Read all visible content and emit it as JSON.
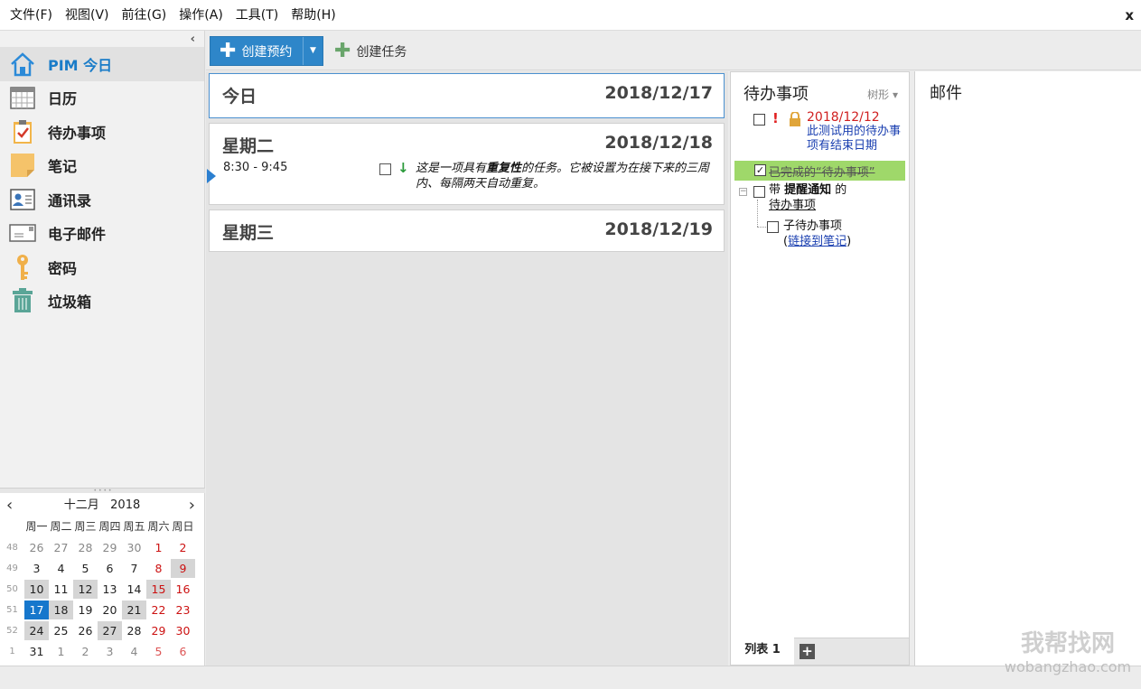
{
  "menu": [
    "文件(F)",
    "视图(V)",
    "前往(G)",
    "操作(A)",
    "工具(T)",
    "帮助(H)"
  ],
  "window_close": "x",
  "sidebar": {
    "collapse": "‹",
    "items": [
      {
        "label": "PIM 今日",
        "icon": "home-icon",
        "active": true
      },
      {
        "label": "日历",
        "icon": "calendar-icon"
      },
      {
        "label": "待办事项",
        "icon": "todo-clipboard-icon"
      },
      {
        "label": "笔记",
        "icon": "note-icon"
      },
      {
        "label": "通讯录",
        "icon": "contacts-icon"
      },
      {
        "label": "电子邮件",
        "icon": "email-icon"
      },
      {
        "label": "密码",
        "icon": "key-icon"
      },
      {
        "label": "垃圾箱",
        "icon": "trash-icon"
      }
    ]
  },
  "minical": {
    "month": "十二月",
    "year": "2018",
    "prev": "‹",
    "next": "›",
    "weekdays": [
      "周一",
      "周二",
      "周三",
      "周四",
      "周五",
      "周六",
      "周日"
    ],
    "weeks": [
      {
        "wk": "48",
        "days": [
          "26",
          "27",
          "28",
          "29",
          "30",
          "1",
          "2"
        ]
      },
      {
        "wk": "49",
        "days": [
          "3",
          "4",
          "5",
          "6",
          "7",
          "8",
          "9"
        ]
      },
      {
        "wk": "50",
        "days": [
          "10",
          "11",
          "12",
          "13",
          "14",
          "15",
          "16"
        ]
      },
      {
        "wk": "51",
        "days": [
          "17",
          "18",
          "19",
          "20",
          "21",
          "22",
          "23"
        ]
      },
      {
        "wk": "52",
        "days": [
          "24",
          "25",
          "26",
          "27",
          "28",
          "29",
          "30"
        ]
      },
      {
        "wk": "1",
        "days": [
          "31",
          "1",
          "2",
          "3",
          "4",
          "5",
          "6"
        ]
      }
    ]
  },
  "toolbar": {
    "new_appointment": "创建预约",
    "new_task": "创建任务"
  },
  "days": [
    {
      "name": "今日",
      "date": "2018/12/17"
    },
    {
      "name": "星期二",
      "date": "2018/12/18",
      "appt_time": "8:30 - 9:45",
      "appt_pre": "这是一项具有",
      "appt_bold": "重复性",
      "appt_post": "的任务。它被设置为在接下来的三周内、每隔两天自动重复。"
    },
    {
      "name": "星期三",
      "date": "2018/12/19"
    }
  ],
  "todo": {
    "title": "待办事项",
    "view_mode": "树形",
    "item1_date": "2018/12/12",
    "item1_desc": "此测试用的待办事项有结束日期",
    "item2": "已完成的“待办事项”",
    "item3_pre": "带 ",
    "item3_bold": "提醒通知",
    "item3_mid": " 的",
    "item3_link": "待办事项",
    "item4": "子待办事项",
    "item4_open": "(",
    "item4_link": "链接到笔记",
    "item4_close": ")",
    "list_tab": "列表 1",
    "add_tab": "+"
  },
  "mail": {
    "title": "邮件"
  },
  "watermark": {
    "line1": "我帮找网",
    "line2": "wobangzhao.com"
  }
}
